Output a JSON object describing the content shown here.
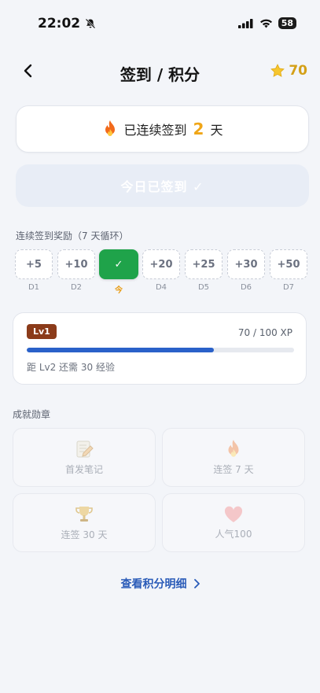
{
  "status": {
    "time": "22:02",
    "battery": "58"
  },
  "nav": {
    "title": "签到 / 积分",
    "points": "70"
  },
  "streak": {
    "prefix": "已连续签到",
    "count": "2",
    "suffix": "天"
  },
  "checkin": {
    "label": "今日已签到 ✓"
  },
  "rewards": {
    "label": "连续签到奖励（7 天循环）",
    "days": [
      {
        "reward": "+5",
        "label": "D1"
      },
      {
        "reward": "+10",
        "label": "D2"
      },
      {
        "reward": "✓",
        "label": "今"
      },
      {
        "reward": "+20",
        "label": "D4"
      },
      {
        "reward": "+25",
        "label": "D5"
      },
      {
        "reward": "+30",
        "label": "D6"
      },
      {
        "reward": "+50",
        "label": "D7"
      }
    ]
  },
  "level": {
    "badge": "Lv1",
    "xp": "70 / 100 XP",
    "progress": 0.7,
    "next": "距 Lv2 还需 30 经验"
  },
  "badges": {
    "label": "成就勋章",
    "items": [
      {
        "icon": "memo-icon",
        "name": "首发笔记"
      },
      {
        "icon": "fire-icon",
        "name": "连签 7 天"
      },
      {
        "icon": "trophy-icon",
        "name": "连签 30 天"
      },
      {
        "icon": "heart-icon",
        "name": "人气100"
      }
    ]
  },
  "footer": {
    "link": "查看积分明细"
  },
  "colors": {
    "accent": "#2a61c9",
    "streak": "#f0a617",
    "today": "#1fa34a",
    "level_badge": "#8b3b1a"
  }
}
